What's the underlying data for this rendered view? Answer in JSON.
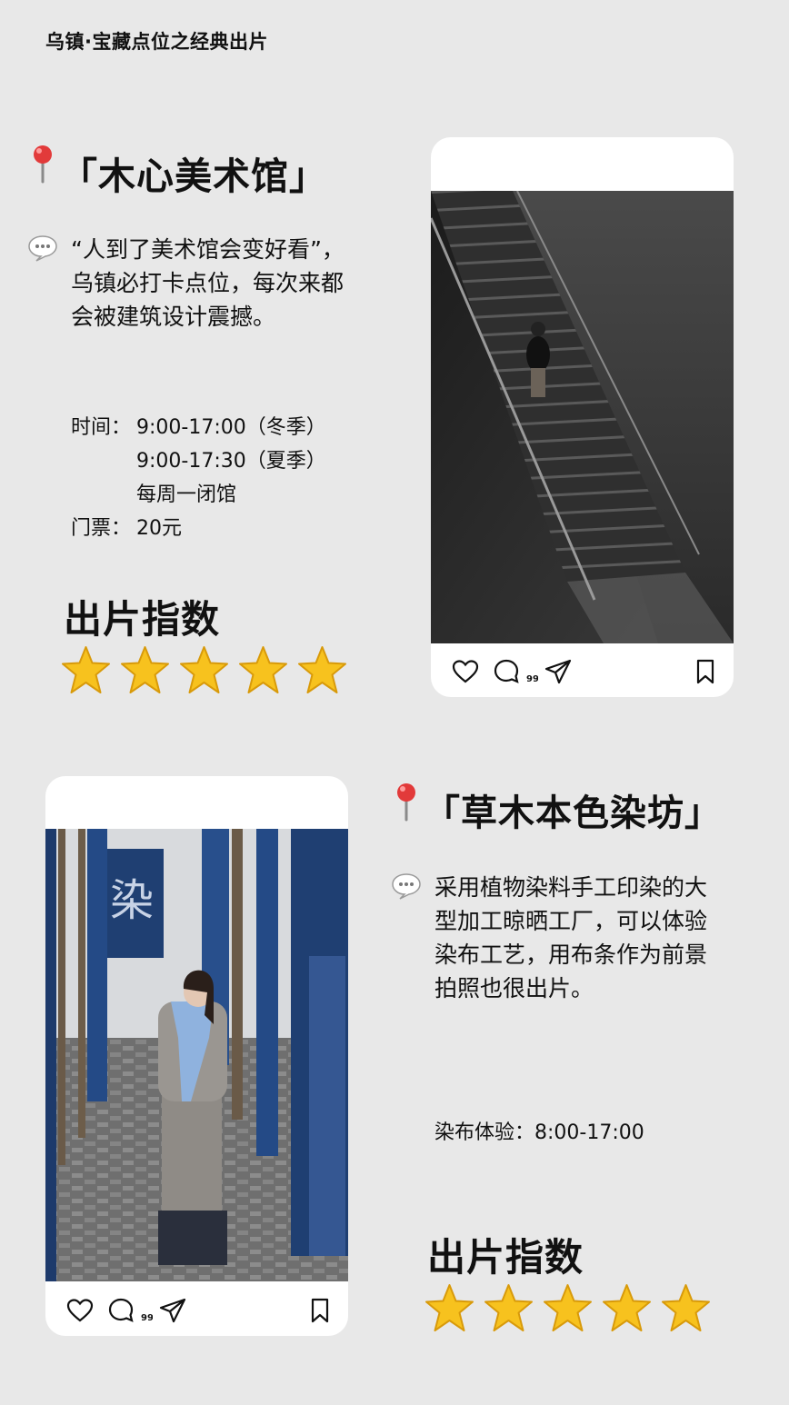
{
  "page": {
    "title": "乌镇·宝藏点位之经典出片"
  },
  "spots": [
    {
      "title": "「木心美术馆」",
      "desc_lines": [
        "“人到了美术馆会变好看”，",
        "乌镇必打卡点位，每次来都",
        "会被建筑设计震撼。"
      ],
      "info": [
        {
          "label": "时间：",
          "value": "9:00-17:00（冬季）"
        },
        {
          "label": "",
          "value": "9:00-17:30（夏季）"
        },
        {
          "label": "",
          "value": "每周一闭馆"
        },
        {
          "label": "门票：",
          "value": "20元"
        }
      ],
      "score_label": "出片指数",
      "stars": 5
    },
    {
      "title": "「草木本色染坊」",
      "desc_lines": [
        "采用植物染料手工印染的大",
        "型加工晾晒工厂，可以体验",
        "染布工艺，用布条作为前景",
        "拍照也很出片。"
      ],
      "info": [
        {
          "label": "",
          "value": "染布体验：8:00-17:00"
        }
      ],
      "score_label": "出片指数",
      "stars": 5,
      "photo_banner_char": "染"
    }
  ],
  "post_actions": {
    "comment_badge": "99"
  },
  "icons": [
    "pin-icon",
    "speech-bubble-icon",
    "star-icon",
    "heart-icon",
    "comment-icon",
    "share-icon",
    "bookmark-icon"
  ],
  "colors": {
    "background": "#e8e8e8",
    "card": "#ffffff",
    "star": "#f7c21e",
    "pin": "#e23a3a",
    "indigo": "#1f3f72"
  }
}
